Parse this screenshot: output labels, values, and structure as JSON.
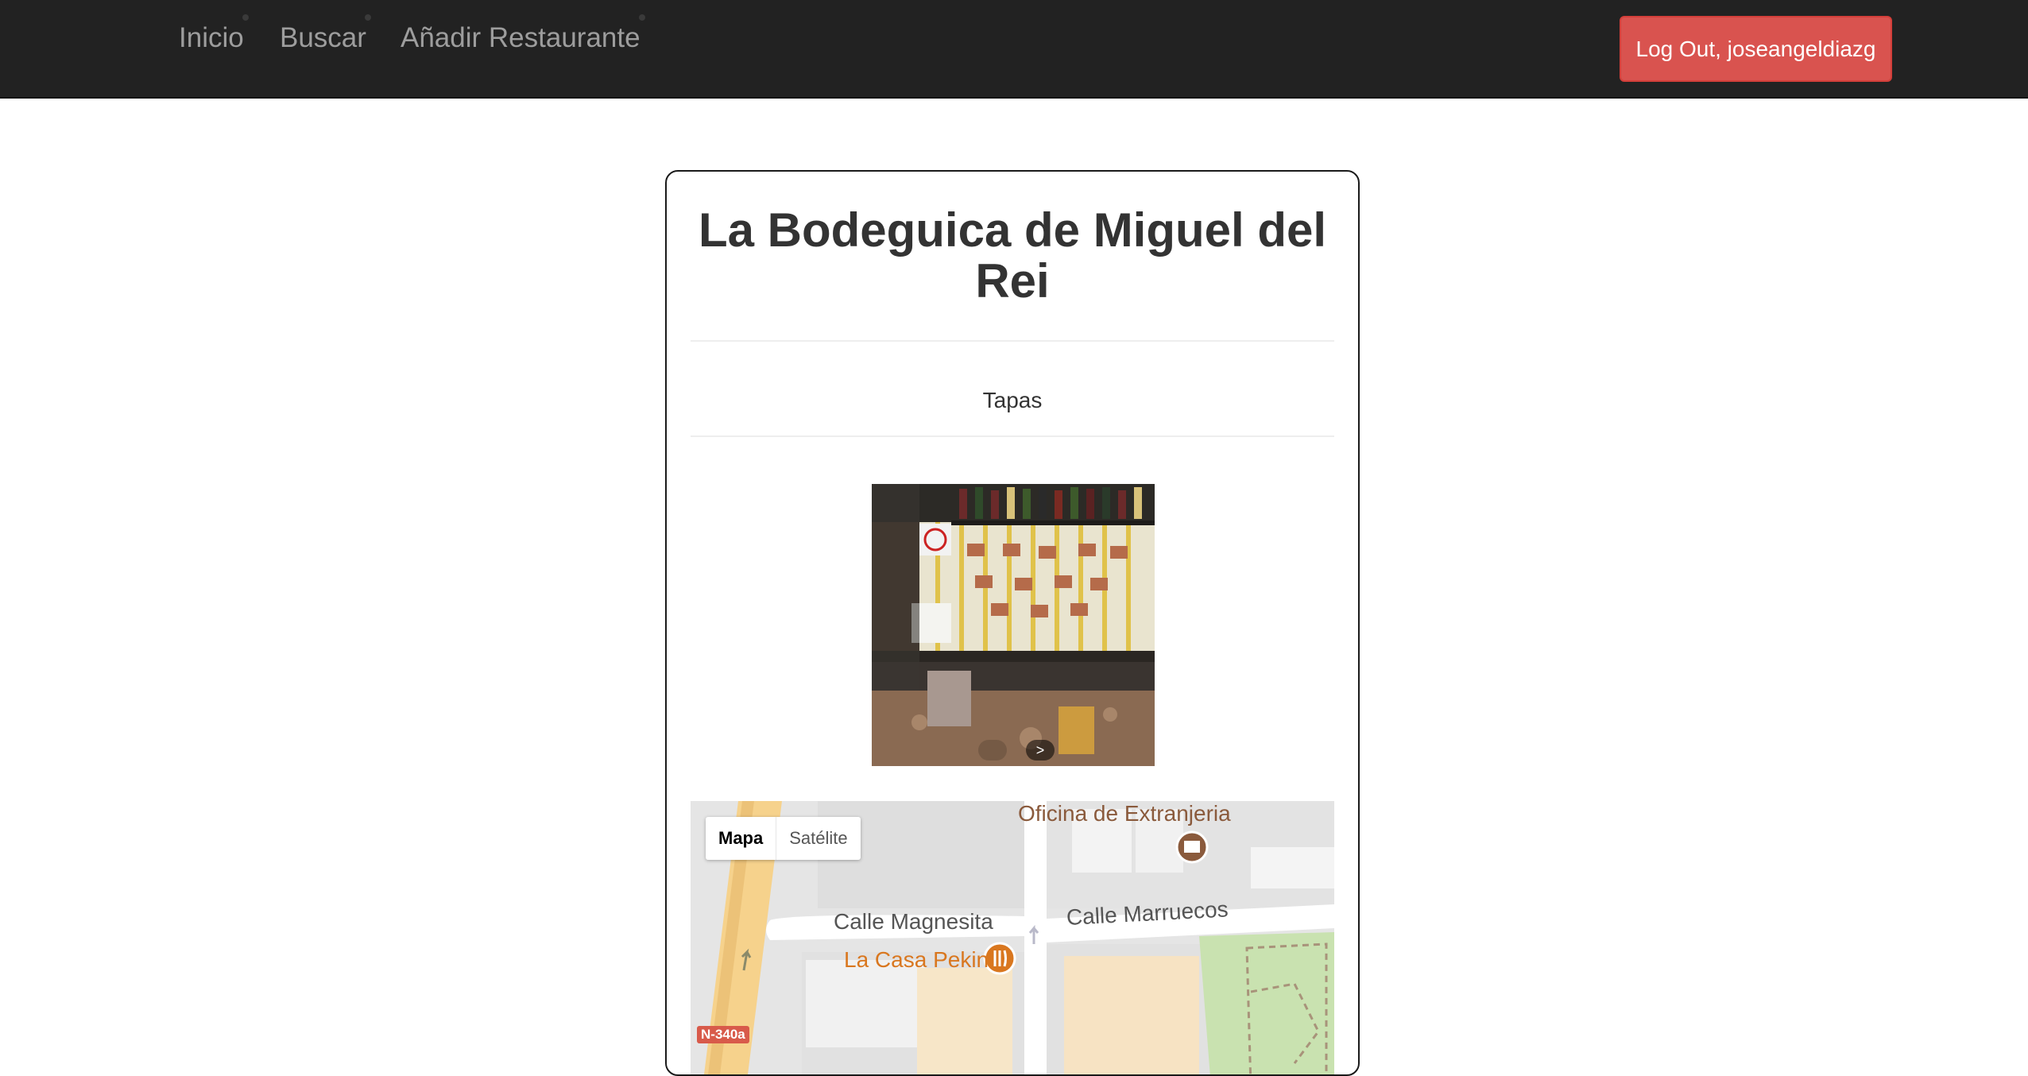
{
  "nav": {
    "links": [
      "Inicio",
      "Buscar",
      "Añadir Restaurante"
    ],
    "logout_label": "Log Out, joseangeldiazg"
  },
  "restaurant": {
    "name": "La Bodeguica de Miguel del Rei",
    "category": "Tapas"
  },
  "carousel": {
    "prev_icon": "chevron-left-icon",
    "next_icon": "chevron-right-icon",
    "next_symbol": ">"
  },
  "map": {
    "toggle": {
      "map_label": "Mapa",
      "satellite_label": "Satélite",
      "selected": "Mapa"
    },
    "labels": {
      "poi_office": "Oficina de Extranjeria",
      "street_1": "Calle Magnesita",
      "street_2": "Calle Marruecos",
      "poi_restaurant": "La Casa Pekin",
      "road_badge": "N-340a"
    },
    "icons": [
      "government-building-icon",
      "restaurant-fork-knife-icon",
      "one-way-arrow-icon"
    ]
  },
  "colors": {
    "navbar_bg": "#222222",
    "nav_link": "#9d9d9d",
    "logout_bg": "#d9534f",
    "poi_brown": "#8a5a3c",
    "poi_orange": "#d9771f"
  }
}
